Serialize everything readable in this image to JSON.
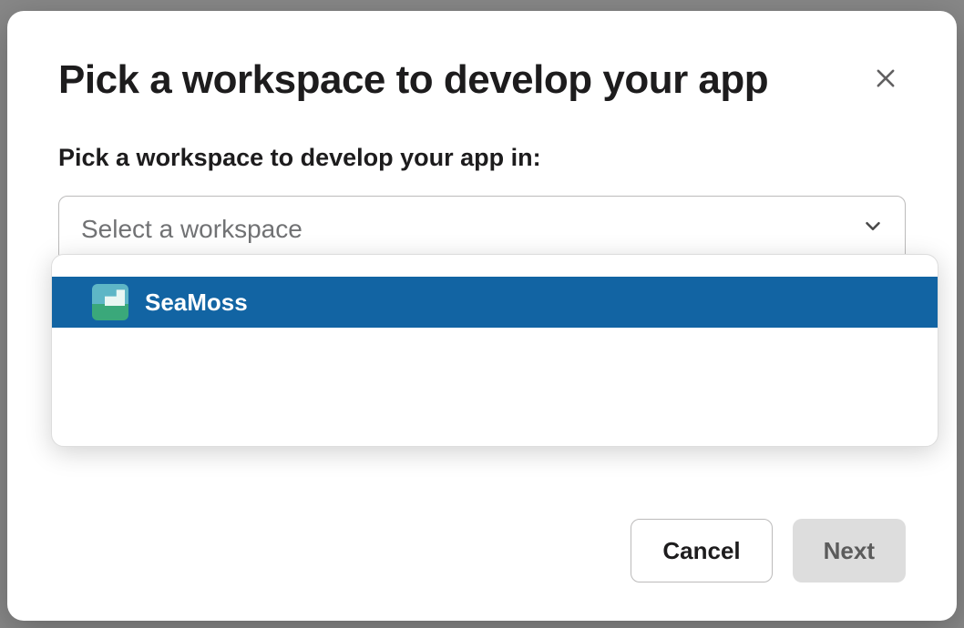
{
  "modal": {
    "title": "Pick a workspace to develop your app",
    "fieldLabel": "Pick a workspace to develop your app in:",
    "select": {
      "placeholder": "Select a workspace",
      "options": [
        {
          "name": "SeaMoss",
          "selected": true
        }
      ]
    },
    "buttons": {
      "cancel": "Cancel",
      "next": "Next"
    }
  }
}
